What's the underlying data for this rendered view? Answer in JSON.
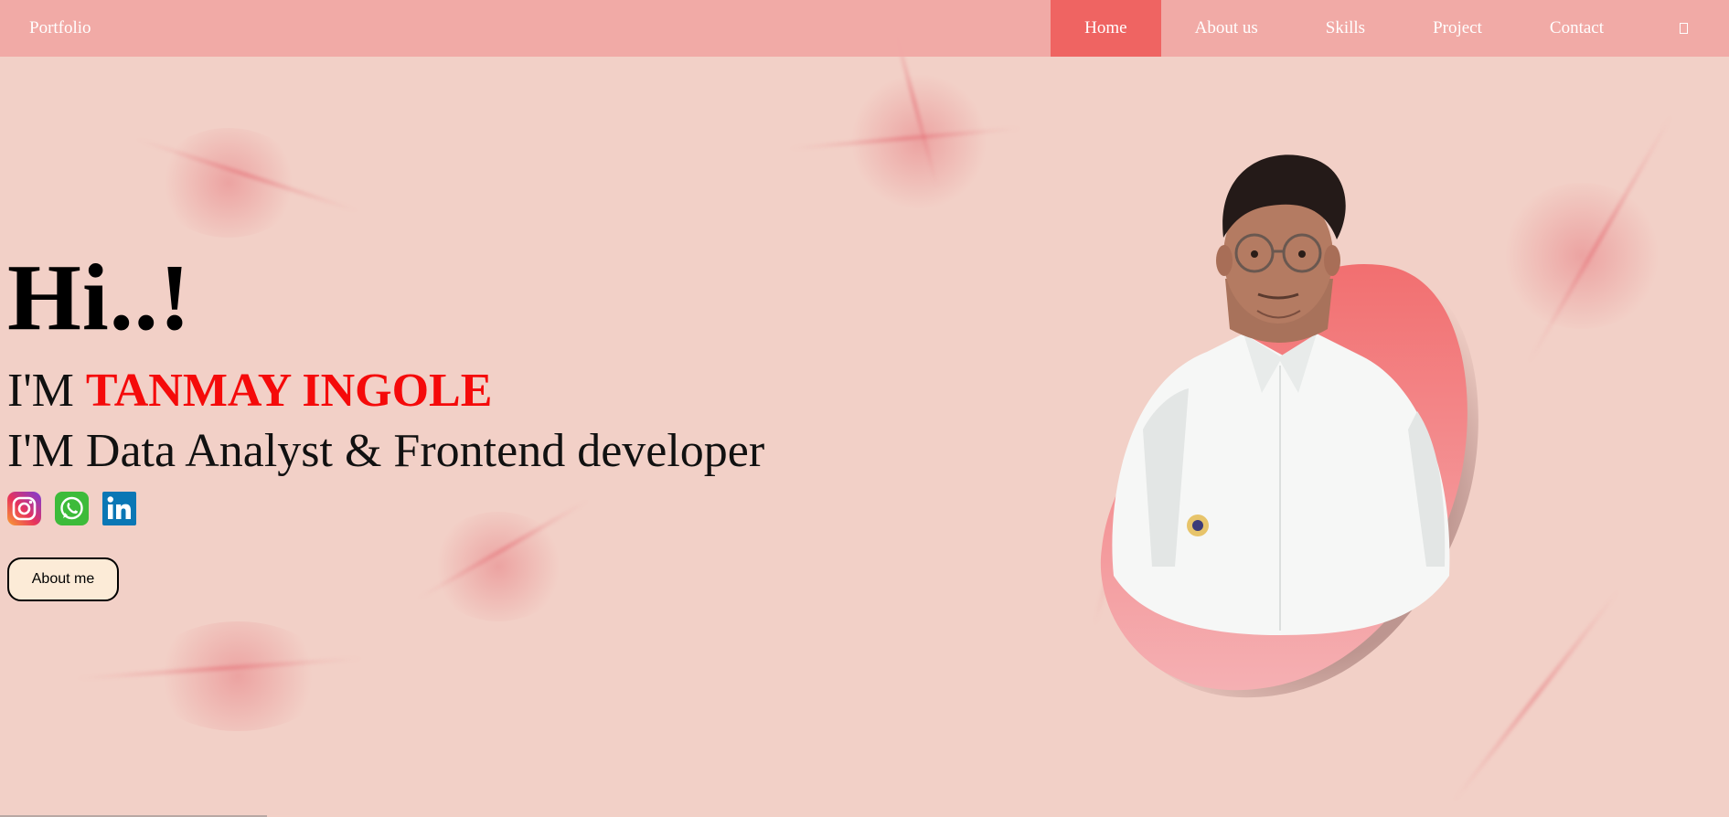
{
  "nav": {
    "brand": "Portfolio",
    "items": [
      {
        "label": "Home",
        "active": true
      },
      {
        "label": "About us",
        "active": false
      },
      {
        "label": "Skills",
        "active": false
      },
      {
        "label": "Project",
        "active": false
      },
      {
        "label": "Contact",
        "active": false
      }
    ],
    "menu_icon": "menu-icon"
  },
  "hero": {
    "greeting": "Hi..!",
    "im_prefix": "I'M ",
    "name": "TANMAY INGOLE",
    "role": "I'M Data Analyst & Frontend developer",
    "socials": [
      "instagram-icon",
      "whatsapp-icon",
      "linkedin-icon"
    ],
    "button_label": "About me"
  },
  "colors": {
    "background": "#f2d0c7",
    "navbar": "#f0a8a4",
    "nav_active": "#ef6462",
    "name_accent": "#f50a0a",
    "button_bg": "#fcebd7",
    "blob": "#f07a78"
  }
}
